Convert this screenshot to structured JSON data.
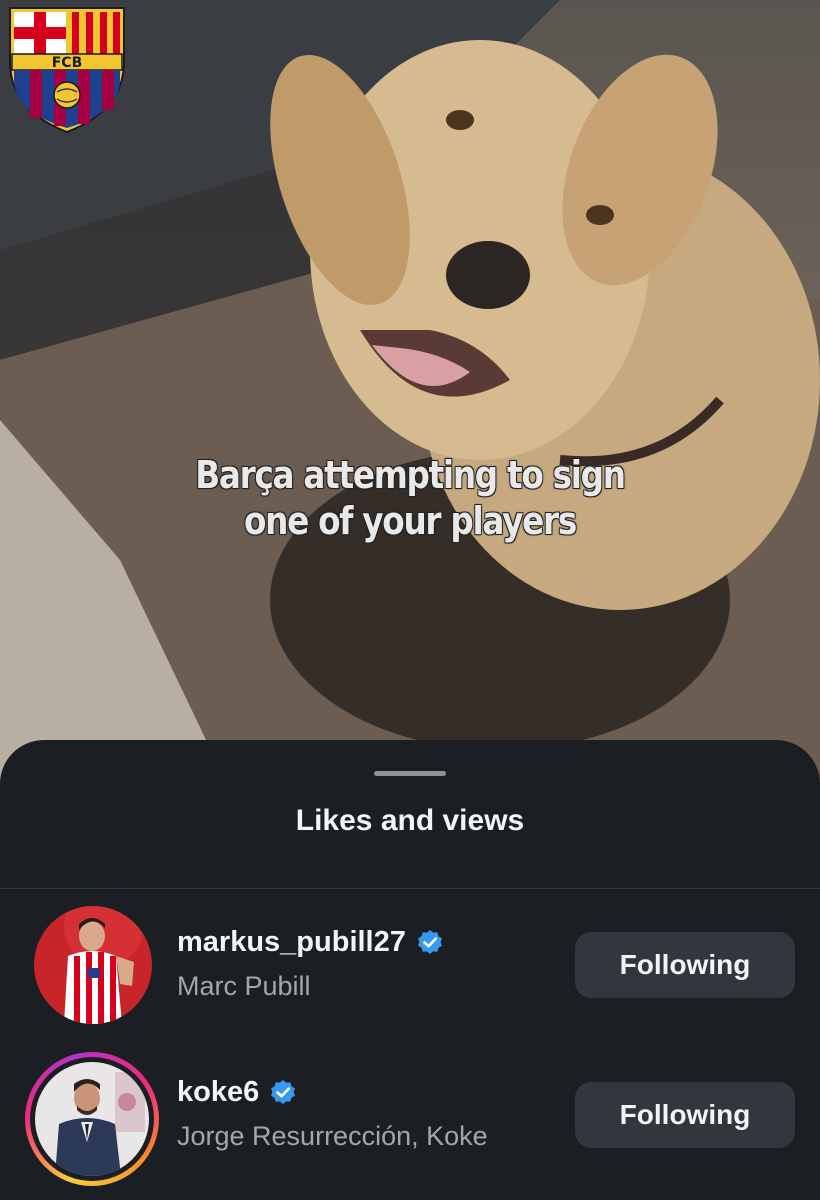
{
  "media": {
    "caption_line1": "Barça attempting to sign",
    "caption_line2": "one of your players",
    "crest_text": "FCB"
  },
  "sheet": {
    "title": "Likes and views"
  },
  "accounts": [
    {
      "username": "markus_pubill27",
      "full_name": "Marc Pubill",
      "verified": true,
      "has_story": false,
      "button_label": "Following"
    },
    {
      "username": "koke6",
      "full_name": "Jorge Resurrección, Koke",
      "verified": true,
      "has_story": true,
      "button_label": "Following"
    }
  ],
  "colors": {
    "sheet_bg": "#1b1e22",
    "button_bg": "#33373d",
    "verified_blue": "#3897f0",
    "secondary_text": "#a3a7ad"
  }
}
